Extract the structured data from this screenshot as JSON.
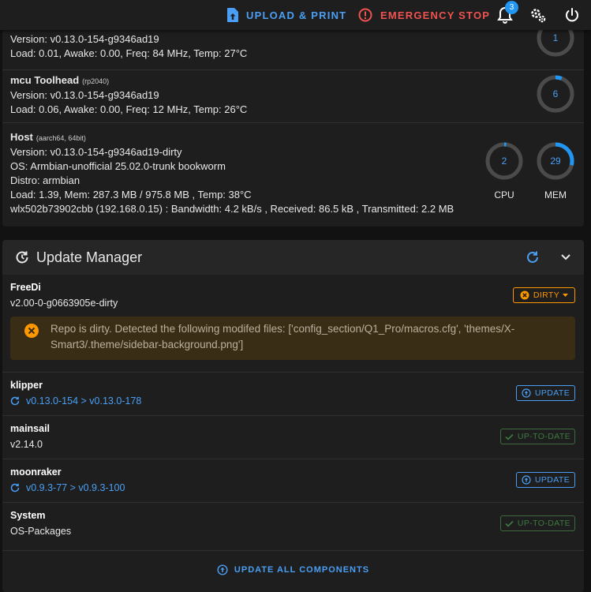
{
  "topbar": {
    "upload_label": "UPLOAD & PRINT",
    "estop_label": "EMERGENCY STOP",
    "notification_count": "3"
  },
  "system": {
    "mcu_main": {
      "version": "Version: v0.13.0-154-g9346ad19",
      "load": "Load: 0.01, Awake: 0.00, Freq: 84 MHz, Temp: 27°C",
      "gauge_value": "1"
    },
    "mcu_toolhead": {
      "name": "mcu Toolhead",
      "chip": "(rp2040)",
      "version": "Version: v0.13.0-154-g9346ad19",
      "load": "Load: 0.06, Awake: 0.00, Freq: 12 MHz, Temp: 26°C",
      "gauge_value": "6"
    },
    "host": {
      "name": "Host",
      "arch": "(aarch64, 64bit)",
      "version": "Version: v0.13.0-154-g9346ad19-dirty",
      "os": "OS: Armbian-unofficial 25.02.0-trunk bookworm",
      "distro": "Distro: armbian",
      "load": "Load: 1.39, Mem: 287.3 MB / 975.8 MB , Temp: 38°C",
      "network": "wlx502b73902cbb (192.168.0.15) : Bandwidth: 4.2 kB/s , Received: 86.5 kB , Transmitted: 2.2 MB",
      "cpu_value": "2",
      "cpu_label": "CPU",
      "mem_value": "29",
      "mem_label": "MEM"
    }
  },
  "update_manager": {
    "title": "Update Manager",
    "components": [
      {
        "name": "FreeDi",
        "version": "v2.00-0-g0663905e-dirty",
        "status": "DIRTY"
      },
      {
        "name": "klipper",
        "version": "v0.13.0-154 > v0.13.0-178",
        "status": "UPDATE"
      },
      {
        "name": "mainsail",
        "version": "v2.14.0",
        "status": "UP-TO-DATE"
      },
      {
        "name": "moonraker",
        "version": "v0.9.3-77 > v0.9.3-100",
        "status": "UPDATE"
      },
      {
        "name": "System",
        "version": "OS-Packages",
        "status": "UP-TO-DATE"
      }
    ],
    "dirty_alert": "Repo is dirty. Detected the following modifed files: ['config_section/Q1_Pro/macros.cfg', 'themes/X-Smart3/.theme/sidebar-background.png']",
    "update_all_label": "UPDATE ALL COMPONENTS"
  },
  "colors": {
    "accent": "#4a9ff5",
    "danger": "#ef5350",
    "warning": "#ff9800",
    "success": "#3d7a41",
    "background": "#121212",
    "card": "#1e1e1e"
  },
  "gauges": {
    "mcu_main_fraction": 0.01,
    "mcu_toolhead_fraction": 0.06,
    "cpu_fraction": 0.02,
    "mem_fraction": 0.29
  }
}
